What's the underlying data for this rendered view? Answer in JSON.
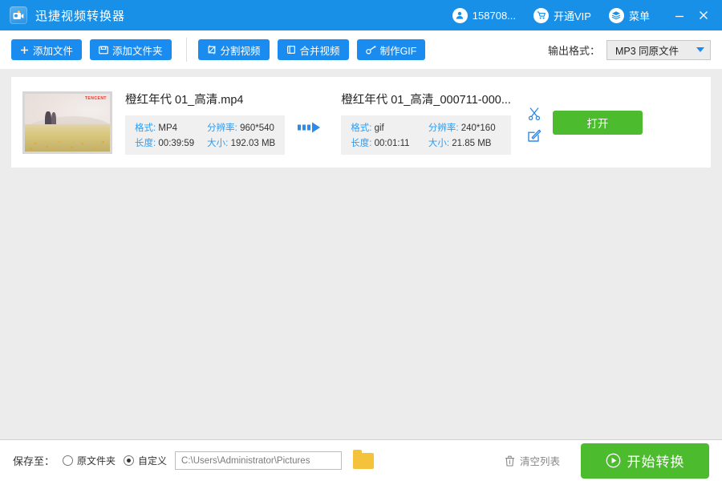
{
  "window": {
    "title": "迅捷视频转换器",
    "logo_icon": "app-logo-icon",
    "account": "158708...",
    "account_icon": "user-icon",
    "vip": "开通VIP",
    "vip_icon": "cart-icon",
    "menu": "菜单",
    "menu_icon": "layers-icon",
    "minimize_icon": "minimize-icon",
    "close_icon": "close-icon"
  },
  "toolbar": {
    "add_file": "添加文件",
    "add_file_icon": "plus-icon",
    "add_folder": "添加文件夹",
    "add_folder_icon": "folder-icon",
    "split_video": "分割视频",
    "split_video_icon": "crop-icon",
    "merge_video": "合并视频",
    "merge_video_icon": "merge-icon",
    "make_gif": "制作GIF",
    "make_gif_icon": "gif-icon",
    "output_format_label": "输出格式：",
    "output_format_value": "MP3  同原文件",
    "caret_icon": "chevron-down-icon"
  },
  "list": {
    "items": [
      {
        "thumbnail_watermark": "TENCENT",
        "source": {
          "filename": "橙红年代 01_高清.mp4",
          "fields": [
            {
              "key": "格式:",
              "value": "MP4"
            },
            {
              "key": "分辨率:",
              "value": "960*540"
            },
            {
              "key": "长度:",
              "value": "00:39:59"
            },
            {
              "key": "大小:",
              "value": "192.03 MB"
            }
          ]
        },
        "arrow_icon": "convert-arrow-icon",
        "output": {
          "filename": "橙红年代 01_高清_000711-000...",
          "fields": [
            {
              "key": "格式:",
              "value": "gif"
            },
            {
              "key": "分辨率:",
              "value": "240*160"
            },
            {
              "key": "长度:",
              "value": "00:01:11"
            },
            {
              "key": "大小:",
              "value": "21.85 MB"
            }
          ]
        },
        "cut_icon": "scissors-icon",
        "edit_icon": "edit-icon",
        "open_button": "打开"
      }
    ]
  },
  "bottom": {
    "save_to_label": "保存至：",
    "option_source": "原文件夹",
    "option_custom": "自定义",
    "selected_option": "custom",
    "path_value": "C:\\Users\\Administrator\\Pictures",
    "folder_icon": "folder-open-icon",
    "clear_list": "清空列表",
    "clear_list_icon": "trash-icon",
    "start_button": "开始转换",
    "start_button_icon": "play-icon"
  },
  "colors": {
    "title_bar": "#1890e8",
    "accent_blue": "#1a8cf0",
    "accent_green": "#4cbb2e",
    "label_blue": "#2f9cf0",
    "page_bg": "#ececec"
  }
}
